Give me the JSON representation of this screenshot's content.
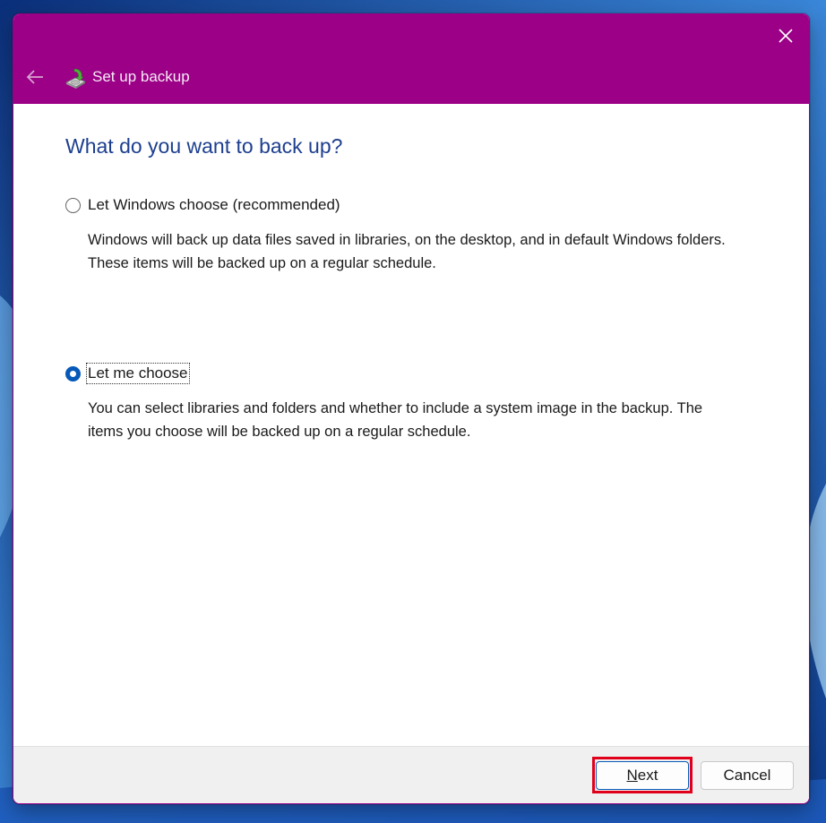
{
  "window": {
    "title": "Set up backup",
    "accent_color": "#9b0087",
    "close_icon": "close-icon",
    "back_icon": "back-arrow-icon",
    "app_icon": "backup-drive-icon"
  },
  "main": {
    "heading": "What do you want to back up?",
    "options": [
      {
        "label": "Let Windows choose (recommended)",
        "description": "Windows will back up data files saved in libraries, on the desktop, and in default Windows folders. These items will be backed up on a regular schedule.",
        "selected": false
      },
      {
        "label": "Let me choose",
        "description": "You can select libraries and folders and whether to include a system image in the backup. The items you choose will be backed up on a regular schedule.",
        "selected": true
      }
    ]
  },
  "footer": {
    "next_accel": "N",
    "next_rest": "ext",
    "cancel_label": "Cancel",
    "highlight_color": "#e0001b"
  }
}
